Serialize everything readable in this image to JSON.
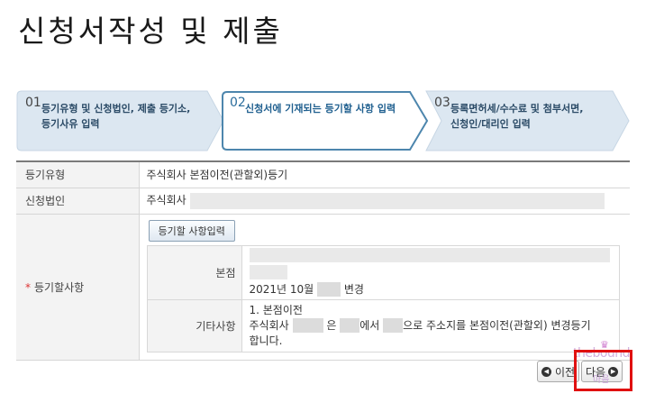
{
  "page": {
    "title": "신청서작성 및 제출"
  },
  "steps": [
    {
      "num": "01",
      "line1": "등기유형 및 신청법인, 제출 등기소,",
      "line2": "등기사유 입력",
      "active": false
    },
    {
      "num": "02",
      "line1": "신청서에 기재되는 등기할 사항 입력",
      "line2": "",
      "active": true
    },
    {
      "num": "03",
      "line1": "등록면허세/수수료 및 첨부서면,",
      "line2": "신청인/대리인 입력",
      "active": false
    }
  ],
  "form": {
    "reg_type_label": "등기유형",
    "reg_type_value": "주식회사 본점이전(관할외)등기",
    "corp_label": "신청법인",
    "corp_value_prefix": "주식회사",
    "items_label": "등기할사항",
    "items_required_mark": "*",
    "input_button": "등기할 사항입력",
    "head_office_label": "본점",
    "head_office_change": "2021년 10월",
    "head_office_change_suffix": "변경",
    "other_label": "기타사항",
    "other_line1": "1. 본점이전",
    "other_line2_a": "주식회사",
    "other_line2_b": "은",
    "other_line2_c": "에서",
    "other_line2_d": "으로 주소지를 본점이전(관할외) 변경등기",
    "other_line3": "합니다."
  },
  "nav": {
    "prev": "이전",
    "next": "다음"
  },
  "watermark": {
    "text": "thebound",
    "sub": "마음"
  },
  "colors": {
    "step_fill": "#dce7f1",
    "step_active_border": "#4d86ad",
    "highlight": "#e01010"
  }
}
